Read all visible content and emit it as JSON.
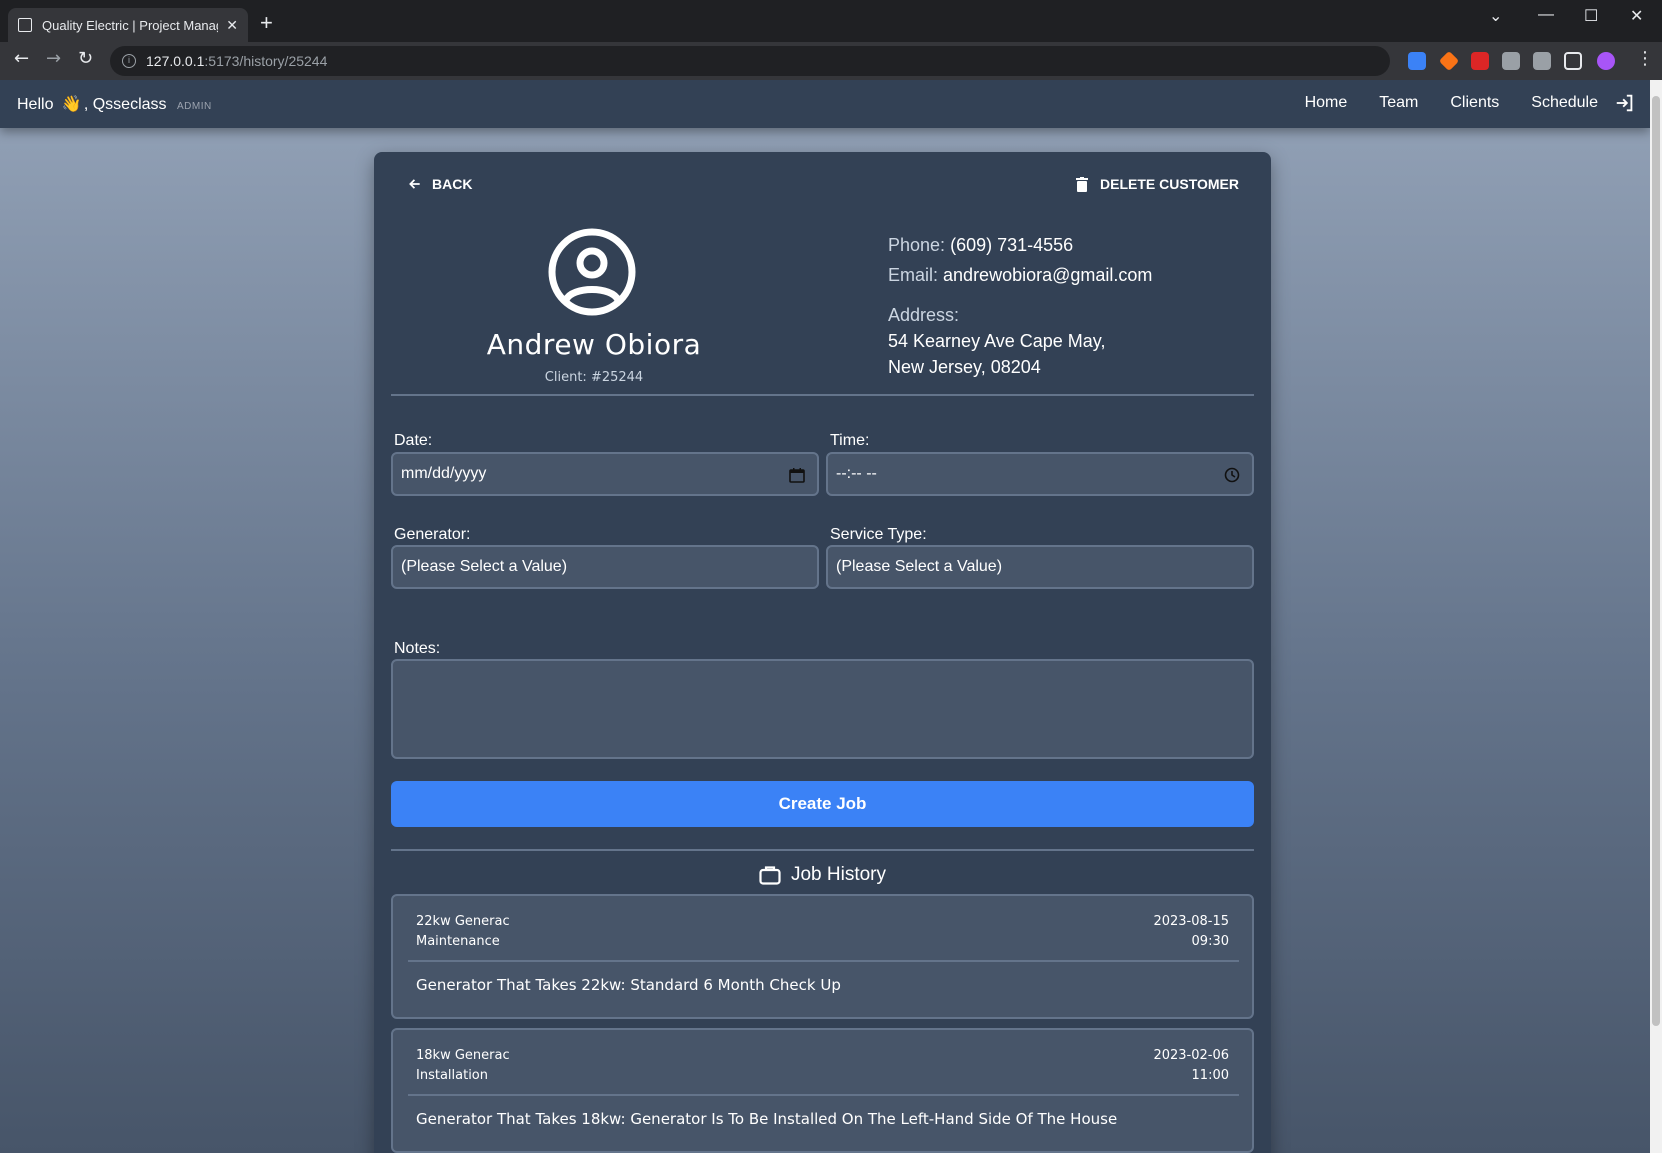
{
  "browser": {
    "tab_title": "Quality Electric | Project Manager",
    "tab_close": "✕",
    "new_tab": "+",
    "url_host": "127.0.0.1",
    "url_path": ":5173/history/25244",
    "window_min": "—",
    "window_max": "☐",
    "window_close": "✕",
    "tab_menu": "⌄"
  },
  "header": {
    "greeting": "Hello",
    "wave": "👋",
    "username": ", Qsseclass",
    "role": "ADMIN",
    "nav": [
      "Home",
      "Team",
      "Clients",
      "Schedule"
    ]
  },
  "customer": {
    "back_label": "BACK",
    "delete_label": "DELETE CUSTOMER",
    "name": "Andrew Obiora",
    "client_id": "Client: #25244",
    "phone_label": "Phone:",
    "phone": "(609) 731-4556",
    "email_label": "Email:",
    "email": "andrewobiora@gmail.com",
    "address_label": "Address:",
    "address_line1": "54 Kearney Ave Cape May,",
    "address_line2": "New Jersey, 08204"
  },
  "form": {
    "date_label": "Date:",
    "date_placeholder": "mm/dd/yyyy",
    "time_label": "Time:",
    "time_placeholder": "--:-- --",
    "generator_label": "Generator:",
    "generator_value": "(Please Select a Value)",
    "service_label": "Service Type:",
    "service_value": "(Please Select a Value)",
    "notes_label": "Notes:",
    "notes_value": "",
    "submit_label": "Create Job"
  },
  "job_history": {
    "title": "Job History",
    "jobs": [
      {
        "generator": "22kw Generac",
        "service_type": "Maintenance",
        "date": "2023-08-15",
        "time": "09:30",
        "description": "Generator That Takes 22kw: Standard 6 Month Check Up"
      },
      {
        "generator": "18kw Generac",
        "service_type": "Installation",
        "date": "2023-02-06",
        "time": "11:00",
        "description": "Generator That Takes 18kw: Generator Is To Be Installed On The Left-Hand Side Of The House"
      }
    ]
  },
  "colors": {
    "accent": "#3b82f6",
    "card": "#334155",
    "field": "#475569"
  }
}
